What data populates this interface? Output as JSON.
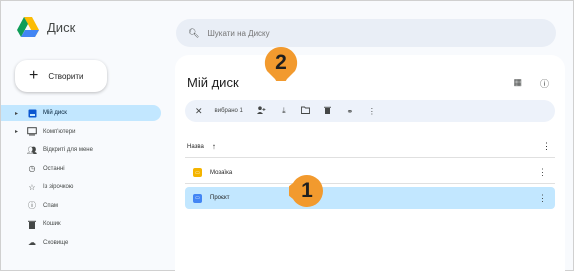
{
  "app": {
    "name": "Диск"
  },
  "search": {
    "placeholder": "Шукати на Диску"
  },
  "new_button": {
    "label": "Створити"
  },
  "sidebar": {
    "items": [
      {
        "label": "Мій диск",
        "icon": "my-drive-icon",
        "active": true
      },
      {
        "label": "Комп'ютери",
        "icon": "computer-icon",
        "active": false
      },
      {
        "label": "Відкриті для мене",
        "icon": "shared-icon",
        "active": false
      },
      {
        "label": "Останні",
        "icon": "clock-icon",
        "active": false
      },
      {
        "label": "Із зірочкою",
        "icon": "star-icon",
        "active": false
      },
      {
        "label": "Спам",
        "icon": "spam-icon",
        "active": false
      },
      {
        "label": "Кошик",
        "icon": "trash-icon",
        "active": false
      },
      {
        "label": "Сховище",
        "icon": "cloud-icon",
        "active": false
      }
    ]
  },
  "main": {
    "title": "Мій диск",
    "toolbar": {
      "selected_label": "вибрано 1"
    },
    "columns": {
      "name": "Назва"
    },
    "files": [
      {
        "name": "Мозаїка",
        "type": "slides",
        "color": "#f4b400",
        "selected": false
      },
      {
        "name": "Проєкт",
        "type": "docs",
        "color": "#4285f4",
        "selected": true
      }
    ]
  },
  "callouts": [
    {
      "number": "1",
      "color": "#f29a2e"
    },
    {
      "number": "2",
      "color": "#f29a2e"
    }
  ],
  "colors": {
    "accent": "#c2e7ff",
    "callout": "#f29a2e"
  }
}
